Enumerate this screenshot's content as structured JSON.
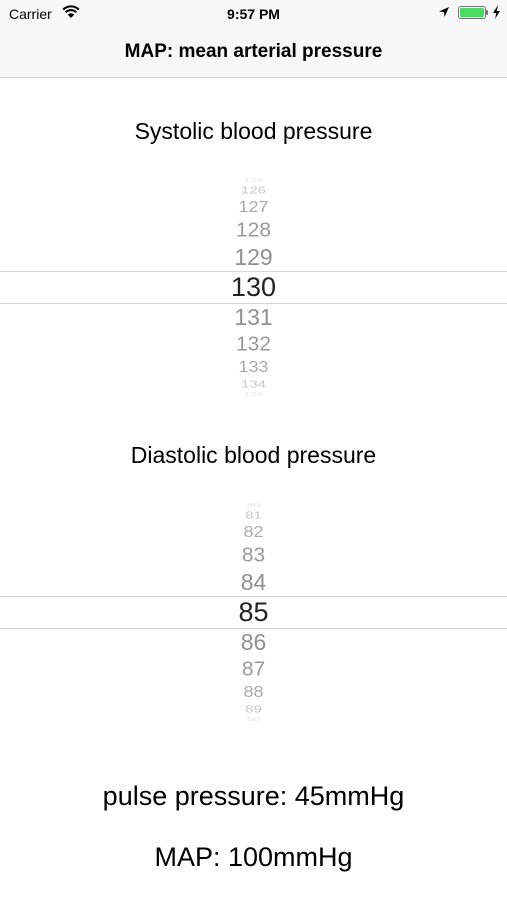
{
  "status_bar": {
    "carrier": "Carrier",
    "time": "9:57 PM",
    "battery_color": "#4cd964"
  },
  "nav": {
    "title": "MAP: mean arterial pressure"
  },
  "systolic": {
    "label": "Systolic blood pressure",
    "values": [
      "125",
      "126",
      "127",
      "128",
      "129",
      "130",
      "131",
      "132",
      "133",
      "134",
      "135"
    ],
    "selected": "130"
  },
  "diastolic": {
    "label": "Diastolic blood pressure",
    "values": [
      "80",
      "81",
      "82",
      "83",
      "84",
      "85",
      "86",
      "87",
      "88",
      "89",
      "90"
    ],
    "selected": "85"
  },
  "results": {
    "pulse_pressure": "pulse pressure: 45mmHg",
    "map": "MAP: 100mmHg"
  }
}
